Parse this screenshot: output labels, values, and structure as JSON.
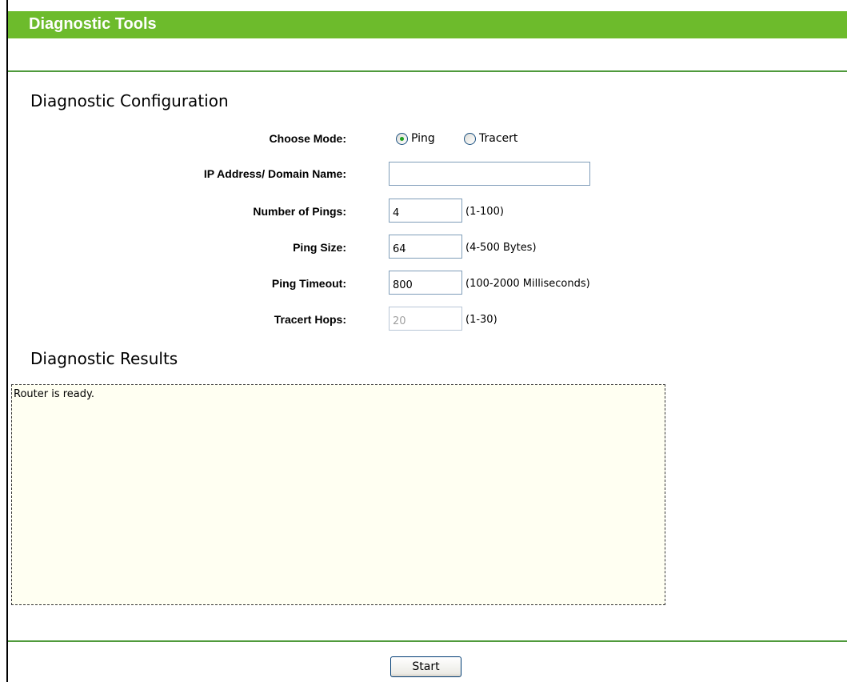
{
  "header": {
    "title": "Diagnostic Tools"
  },
  "config": {
    "heading": "Diagnostic Configuration",
    "mode": {
      "label": "Choose Mode:",
      "options": [
        "Ping",
        "Tracert"
      ],
      "selected": "Ping"
    },
    "ip_address": {
      "label": "IP Address/ Domain Name:",
      "value": ""
    },
    "num_pings": {
      "label": "Number of Pings:",
      "value": "4",
      "hint": "(1-100)"
    },
    "ping_size": {
      "label": "Ping Size:",
      "value": "64",
      "hint": "(4-500 Bytes)"
    },
    "ping_timeout": {
      "label": "Ping Timeout:",
      "value": "800",
      "hint": "(100-2000 Milliseconds)"
    },
    "tracert_hops": {
      "label": "Tracert Hops:",
      "value": "20",
      "hint": "(1-30)",
      "disabled": true
    }
  },
  "results": {
    "heading": "Diagnostic Results",
    "text": "Router is ready."
  },
  "actions": {
    "start_label": "Start"
  },
  "colors": {
    "title_bar": "#6dbb2c",
    "divider": "#4f9a3c",
    "results_bg": "#fffff2",
    "radio_dot": "#21a121"
  }
}
